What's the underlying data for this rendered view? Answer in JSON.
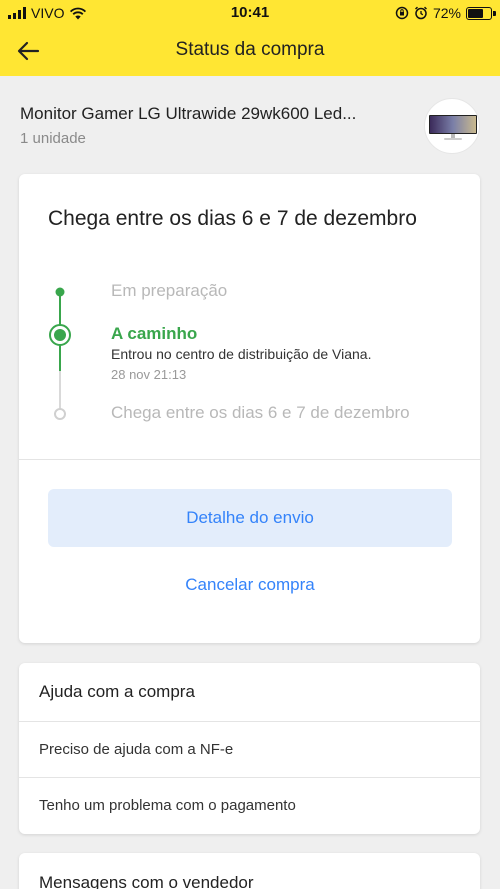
{
  "status_bar": {
    "carrier": "VIVO",
    "time": "10:41",
    "battery": "72%",
    "battery_level": 0.72
  },
  "nav": {
    "title": "Status da compra",
    "back_icon": "arrow-left-icon"
  },
  "product": {
    "name": "Monitor Gamer LG Ultrawide 29wk600 Led...",
    "quantity": "1 unidade"
  },
  "shipment": {
    "title": "Chega entre os dias 6 e 7 de dezembro",
    "steps": [
      {
        "label": "Em preparação",
        "state": "done"
      },
      {
        "label": "A caminho",
        "state": "current",
        "description": "Entrou no centro de distribuição de Viana.",
        "date": "28 nov 21:13"
      },
      {
        "label": "Chega entre os dias 6 e 7 de dezembro",
        "state": "pending"
      }
    ],
    "detail_button": "Detalhe do envio",
    "cancel_link": "Cancelar compra"
  },
  "help": {
    "title": "Ajuda com a compra",
    "items": [
      "Preciso de ajuda com a NF-e",
      "Tenho um problema com o pagamento"
    ]
  },
  "messages": {
    "title": "Mensagens com o vendedor"
  },
  "colors": {
    "header_yellow": "#ffe633",
    "accent_blue": "#3483fa",
    "progress_green": "#39a64c"
  }
}
